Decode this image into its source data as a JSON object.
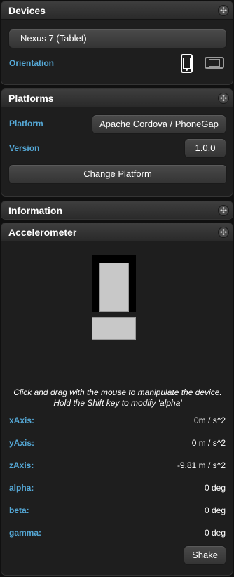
{
  "devices": {
    "title": "Devices",
    "device_select": "Nexus 7 (Tablet)",
    "orientation_label": "Orientation",
    "icons": [
      "portrait-phone-icon",
      "landscape-phone-icon"
    ]
  },
  "platforms": {
    "title": "Platforms",
    "platform_label": "Platform",
    "platform_value": "Apache Cordova / PhoneGap",
    "version_label": "Version",
    "version_value": "1.0.0",
    "change_button": "Change Platform"
  },
  "information": {
    "title": "Information"
  },
  "accelerometer": {
    "title": "Accelerometer",
    "instructions_line1": "Click and drag with the mouse to manipulate the device.",
    "instructions_line2": "Hold the Shift key to modify 'alpha'",
    "rows": [
      {
        "label": "xAxis:",
        "value": "0m / s^2"
      },
      {
        "label": "yAxis:",
        "value": "0 m / s^2"
      },
      {
        "label": "zAxis:",
        "value": "-9.81 m / s^2"
      },
      {
        "label": "alpha:",
        "value": "0 deg"
      },
      {
        "label": "beta:",
        "value": "0 deg"
      },
      {
        "label": "gamma:",
        "value": "0 deg"
      }
    ],
    "shake_button": "Shake"
  },
  "colors": {
    "label_blue": "#55a8d6",
    "panel_bg": "#1e1e1e",
    "page_bg": "#101010"
  },
  "handle_glyph": "✣"
}
